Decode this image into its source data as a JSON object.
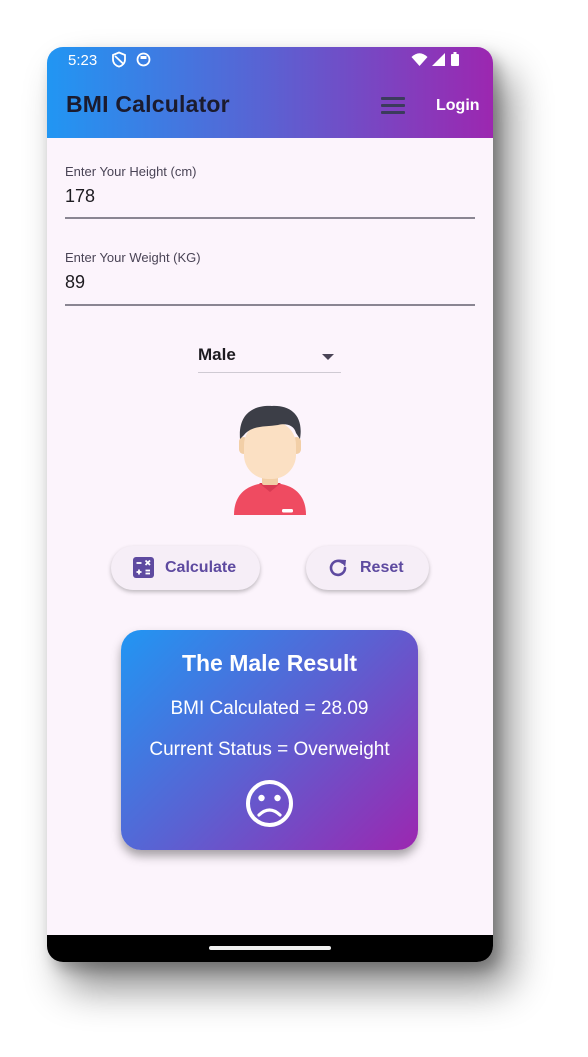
{
  "status_bar": {
    "time": "5:23"
  },
  "app_bar": {
    "title": "BMI Calculator",
    "login_label": "Login"
  },
  "height_field": {
    "label": "Enter Your Height (cm)",
    "value": "178"
  },
  "weight_field": {
    "label": "Enter Your Weight (KG)",
    "value": "89"
  },
  "gender_select": {
    "selected": "Male"
  },
  "buttons": {
    "calculate": "Calculate",
    "reset": "Reset"
  },
  "result": {
    "title": "The Male Result",
    "bmi_line": "BMI Calculated = 28.09",
    "status_line": "Current Status = Overweight",
    "mood_icon": "sad-face-icon"
  },
  "colors": {
    "gradient_start": "#2196f3",
    "gradient_end": "#9c27b0",
    "background": "#fcf4fc",
    "button_text": "#5e4aa0"
  }
}
